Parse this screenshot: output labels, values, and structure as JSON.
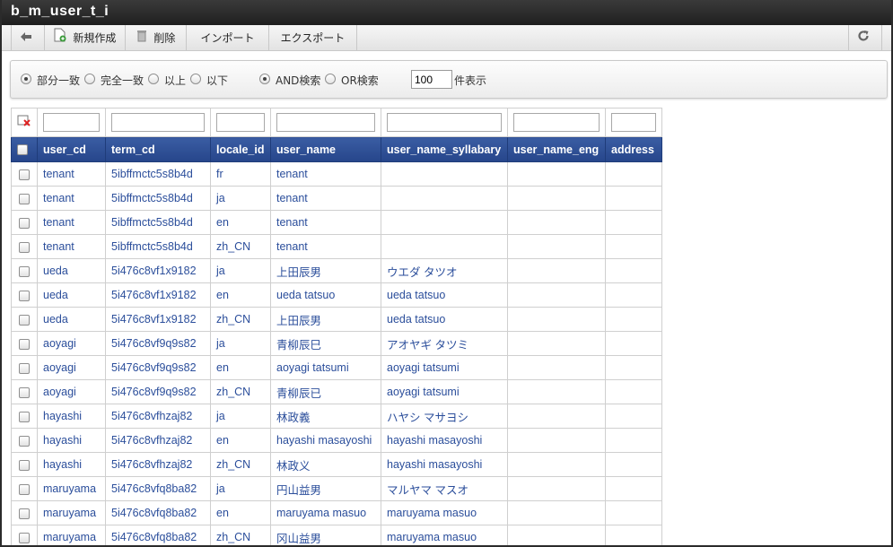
{
  "window": {
    "title": "b_m_user_t_i"
  },
  "toolbar": {
    "new_label": "新規作成",
    "delete_label": "削除",
    "import_label": "インポート",
    "export_label": "エクスポート"
  },
  "search": {
    "options": [
      "部分一致",
      "完全一致",
      "以上",
      "以下"
    ],
    "selected_match": "部分一致",
    "logic_options": [
      "AND検索",
      "OR検索"
    ],
    "selected_logic": "AND検索",
    "count_value": "100",
    "count_suffix": "件表示"
  },
  "grid": {
    "columns": [
      "user_cd",
      "term_cd",
      "locale_id",
      "user_name",
      "user_name_syllabary",
      "user_name_eng",
      "address"
    ],
    "rows": [
      [
        "tenant",
        "5ibffmctc5s8b4d",
        "fr",
        "tenant",
        "",
        "",
        ""
      ],
      [
        "tenant",
        "5ibffmctc5s8b4d",
        "ja",
        "tenant",
        "",
        "",
        ""
      ],
      [
        "tenant",
        "5ibffmctc5s8b4d",
        "en",
        "tenant",
        "",
        "",
        ""
      ],
      [
        "tenant",
        "5ibffmctc5s8b4d",
        "zh_CN",
        "tenant",
        "",
        "",
        ""
      ],
      [
        "ueda",
        "5i476c8vf1x9182",
        "ja",
        "上田辰男",
        "ウエダ タツオ",
        "",
        ""
      ],
      [
        "ueda",
        "5i476c8vf1x9182",
        "en",
        "ueda tatsuo",
        "ueda tatsuo",
        "",
        ""
      ],
      [
        "ueda",
        "5i476c8vf1x9182",
        "zh_CN",
        "上田辰男",
        "ueda tatsuo",
        "",
        ""
      ],
      [
        "aoyagi",
        "5i476c8vf9q9s82",
        "ja",
        "青柳辰巳",
        "アオヤギ タツミ",
        "",
        ""
      ],
      [
        "aoyagi",
        "5i476c8vf9q9s82",
        "en",
        "aoyagi tatsumi",
        "aoyagi tatsumi",
        "",
        ""
      ],
      [
        "aoyagi",
        "5i476c8vf9q9s82",
        "zh_CN",
        "青柳辰已",
        "aoyagi tatsumi",
        "",
        ""
      ],
      [
        "hayashi",
        "5i476c8vfhzaj82",
        "ja",
        "林政義",
        "ハヤシ マサヨシ",
        "",
        ""
      ],
      [
        "hayashi",
        "5i476c8vfhzaj82",
        "en",
        "hayashi masayoshi",
        "hayashi masayoshi",
        "",
        ""
      ],
      [
        "hayashi",
        "5i476c8vfhzaj82",
        "zh_CN",
        "林政义",
        "hayashi masayoshi",
        "",
        ""
      ],
      [
        "maruyama",
        "5i476c8vfq8ba82",
        "ja",
        "円山益男",
        "マルヤマ マスオ",
        "",
        ""
      ],
      [
        "maruyama",
        "5i476c8vfq8ba82",
        "en",
        "maruyama masuo",
        "maruyama masuo",
        "",
        ""
      ],
      [
        "maruyama",
        "5i476c8vfq8ba82",
        "zh_CN",
        "冈山益男",
        "maruyama masuo",
        "",
        ""
      ]
    ]
  },
  "colors": {
    "header_bg": "#2b4b8f",
    "cell_text": "#2b4e9b",
    "titlebar_bg": "#2a2a2a"
  }
}
